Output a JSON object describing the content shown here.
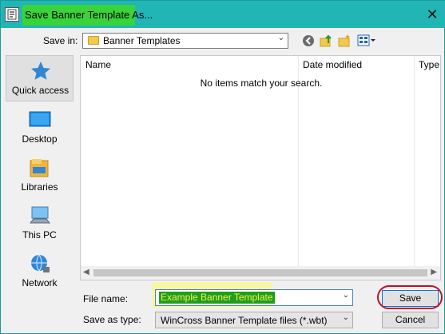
{
  "window": {
    "title": "Save Banner Template As...",
    "close_glyph": "✕",
    "colors": {
      "titlebar": "#22b5b6",
      "title_highlight": "#39d33a"
    }
  },
  "toolbar": {
    "save_in_label": "Save in:",
    "location": "Banner Templates",
    "icons": [
      "back-icon",
      "up-folder-icon",
      "new-folder-icon",
      "views-menu-icon"
    ]
  },
  "places": [
    {
      "label": "Quick access",
      "icon": "star-icon"
    },
    {
      "label": "Desktop",
      "icon": "desktop-icon"
    },
    {
      "label": "Libraries",
      "icon": "libraries-icon"
    },
    {
      "label": "This PC",
      "icon": "computer-icon"
    },
    {
      "label": "Network",
      "icon": "network-icon"
    }
  ],
  "file_list": {
    "columns": [
      "Name",
      "Date modified",
      "Type"
    ],
    "empty_message": "No items match your search."
  },
  "form": {
    "file_name_label": "File name:",
    "file_name_value": "Example Banner Template",
    "save_as_type_label": "Save as type:",
    "save_as_type_value": "WinCross Banner Template files (*.wbt)",
    "highlight_color": "#f7f7a3"
  },
  "buttons": {
    "save": "Save",
    "cancel": "Cancel",
    "save_ring_color": "#c0102a"
  }
}
